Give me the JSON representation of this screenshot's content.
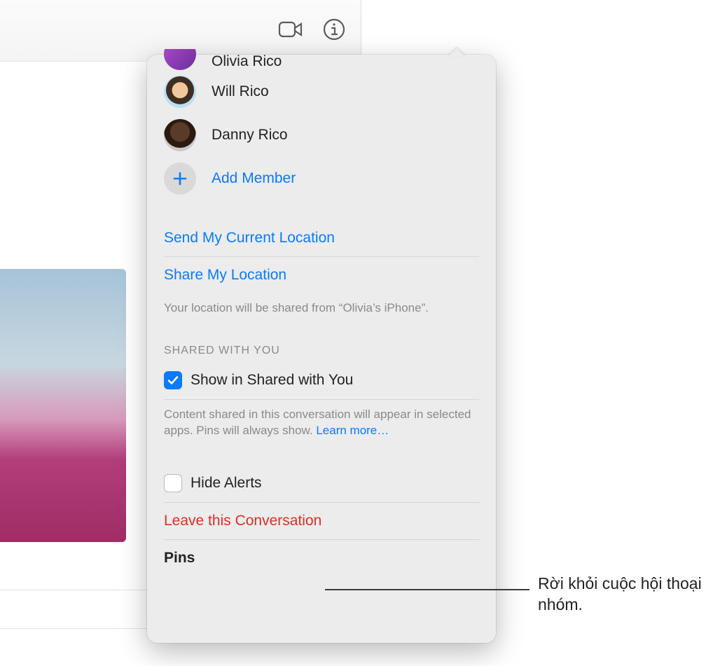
{
  "toolbar": {
    "video_icon": "video-icon",
    "info_icon": "info-icon"
  },
  "popover": {
    "members": [
      {
        "name": "Olivia Rico"
      },
      {
        "name": "Will Rico"
      },
      {
        "name": "Danny Rico"
      }
    ],
    "add_member_label": "Add Member",
    "send_location_label": "Send My Current Location",
    "share_location_label": "Share My Location",
    "share_location_hint": "Your location will be shared from “Olivia’s iPhone”.",
    "shared_with_you_header": "SHARED WITH YOU",
    "show_shared_label": "Show in Shared with You",
    "show_shared_checked": true,
    "shared_hint_text": "Content shared in this conversation will appear in selected apps. Pins will always show. ",
    "shared_hint_link": "Learn more…",
    "hide_alerts_label": "Hide Alerts",
    "hide_alerts_checked": false,
    "leave_label": "Leave this Conversation",
    "pins_label": "Pins"
  },
  "callout": {
    "text": "Rời khỏi cuộc hội thoại nhóm."
  }
}
